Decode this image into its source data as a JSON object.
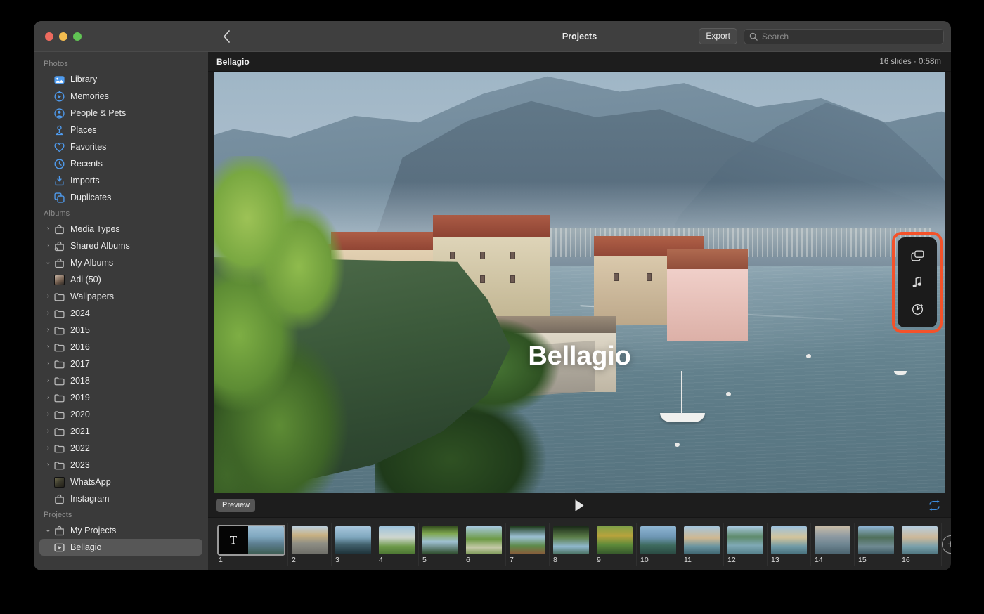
{
  "window": {
    "traffic_lights": [
      "close",
      "minimize",
      "zoom"
    ]
  },
  "sidebar": {
    "sections": [
      {
        "title": "Photos",
        "items": [
          {
            "label": "Library",
            "icon": "library-icon",
            "indent": 0,
            "disclosure": "none",
            "selected": false
          },
          {
            "label": "Memories",
            "icon": "memories-icon",
            "indent": 0,
            "disclosure": "none",
            "selected": false
          },
          {
            "label": "People & Pets",
            "icon": "people-icon",
            "indent": 0,
            "disclosure": "none",
            "selected": false
          },
          {
            "label": "Places",
            "icon": "places-pin-icon",
            "indent": 0,
            "disclosure": "none",
            "selected": false
          },
          {
            "label": "Favorites",
            "icon": "heart-icon",
            "indent": 0,
            "disclosure": "none",
            "selected": false
          },
          {
            "label": "Recents",
            "icon": "clock-icon",
            "indent": 0,
            "disclosure": "none",
            "selected": false
          },
          {
            "label": "Imports",
            "icon": "import-icon",
            "indent": 0,
            "disclosure": "none",
            "selected": false
          },
          {
            "label": "Duplicates",
            "icon": "duplicates-icon",
            "indent": 0,
            "disclosure": "none",
            "selected": false
          }
        ]
      },
      {
        "title": "Albums",
        "items": [
          {
            "label": "Media Types",
            "icon": "album-bag-icon",
            "indent": 0,
            "disclosure": "collapsed",
            "selected": false
          },
          {
            "label": "Shared Albums",
            "icon": "shared-album-icon",
            "indent": 0,
            "disclosure": "collapsed",
            "selected": false
          },
          {
            "label": "My Albums",
            "icon": "album-bag-icon",
            "indent": 0,
            "disclosure": "expanded",
            "selected": false
          },
          {
            "label": "Adi (50)",
            "icon": "album-thumbnail-icon",
            "indent": 1,
            "disclosure": "none",
            "selected": false
          },
          {
            "label": "Wallpapers",
            "icon": "folder-icon",
            "indent": 1,
            "disclosure": "collapsed",
            "selected": false
          },
          {
            "label": "2024",
            "icon": "folder-icon",
            "indent": 1,
            "disclosure": "collapsed",
            "selected": false
          },
          {
            "label": "2015",
            "icon": "folder-icon",
            "indent": 1,
            "disclosure": "collapsed",
            "selected": false
          },
          {
            "label": "2016",
            "icon": "folder-icon",
            "indent": 1,
            "disclosure": "collapsed",
            "selected": false
          },
          {
            "label": "2017",
            "icon": "folder-icon",
            "indent": 1,
            "disclosure": "collapsed",
            "selected": false
          },
          {
            "label": "2018",
            "icon": "folder-icon",
            "indent": 1,
            "disclosure": "collapsed",
            "selected": false
          },
          {
            "label": "2019",
            "icon": "folder-icon",
            "indent": 1,
            "disclosure": "collapsed",
            "selected": false
          },
          {
            "label": "2020",
            "icon": "folder-icon",
            "indent": 1,
            "disclosure": "collapsed",
            "selected": false
          },
          {
            "label": "2021",
            "icon": "folder-icon",
            "indent": 1,
            "disclosure": "collapsed",
            "selected": false
          },
          {
            "label": "2022",
            "icon": "folder-icon",
            "indent": 1,
            "disclosure": "collapsed",
            "selected": false
          },
          {
            "label": "2023",
            "icon": "folder-icon",
            "indent": 1,
            "disclosure": "collapsed",
            "selected": false
          },
          {
            "label": "WhatsApp",
            "icon": "whatsapp-album-thumbnail-icon",
            "indent": 1,
            "disclosure": "none",
            "selected": false
          },
          {
            "label": "Instagram",
            "icon": "album-bag-icon",
            "indent": 1,
            "disclosure": "none",
            "selected": false
          }
        ]
      },
      {
        "title": "Projects",
        "items": [
          {
            "label": "My Projects",
            "icon": "album-bag-icon",
            "indent": 0,
            "disclosure": "expanded",
            "selected": false
          },
          {
            "label": "Bellagio",
            "icon": "slideshow-icon",
            "indent": 1,
            "disclosure": "none",
            "selected": true
          }
        ]
      }
    ]
  },
  "toolbar": {
    "back_icon": "chevron-left-icon",
    "title": "Projects",
    "export_label": "Export",
    "search_icon": "search-icon",
    "search_placeholder": "Search",
    "search_value": ""
  },
  "project_bar": {
    "name": "Bellagio",
    "meta": "16 slides · 0:58m"
  },
  "slide_canvas": {
    "title_text": "Bellagio",
    "scene": "Bellagio town on Lake Como with mountains, buildings, sailboat"
  },
  "inspector": {
    "highlighted": true,
    "highlight_color": "#f4522a",
    "buttons": [
      {
        "name": "slideshow-theme-icon",
        "glyph": "layers"
      },
      {
        "name": "music-note-icon",
        "glyph": "music"
      },
      {
        "name": "duration-timer-icon",
        "glyph": "timer"
      }
    ]
  },
  "transport": {
    "preview_label": "Preview",
    "play_icon": "play-icon",
    "loop_icon": "loop-icon",
    "loop_color": "#3b8bdc"
  },
  "filmstrip": {
    "add_label": "+",
    "add_icon": "add-slide-icon",
    "slides": [
      {
        "num": "1",
        "kind": "title",
        "title_letter": "T",
        "selected": true
      },
      {
        "num": "2",
        "kind": "photo",
        "selected": false
      },
      {
        "num": "3",
        "kind": "photo",
        "selected": false
      },
      {
        "num": "4",
        "kind": "photo",
        "selected": false
      },
      {
        "num": "5",
        "kind": "photo",
        "selected": false
      },
      {
        "num": "6",
        "kind": "photo",
        "selected": false
      },
      {
        "num": "7",
        "kind": "photo",
        "selected": false
      },
      {
        "num": "8",
        "kind": "photo",
        "selected": false
      },
      {
        "num": "9",
        "kind": "photo",
        "selected": false
      },
      {
        "num": "10",
        "kind": "photo",
        "selected": false
      },
      {
        "num": "11",
        "kind": "photo",
        "selected": false
      },
      {
        "num": "12",
        "kind": "photo",
        "selected": false
      },
      {
        "num": "13",
        "kind": "photo",
        "selected": false
      },
      {
        "num": "14",
        "kind": "photo",
        "selected": false
      },
      {
        "num": "15",
        "kind": "photo",
        "selected": false
      },
      {
        "num": "16",
        "kind": "photo",
        "selected": false
      }
    ]
  },
  "colors": {
    "window_bg": "#2b2b2b",
    "sidebar_bg": "#3a3a3a",
    "toolbar_bg": "#3f3f3f",
    "stage_bg": "#1d1d1d",
    "accent_blue": "#3b8bdc",
    "highlight_orange": "#f4522a",
    "selection_gray": "#575757"
  }
}
